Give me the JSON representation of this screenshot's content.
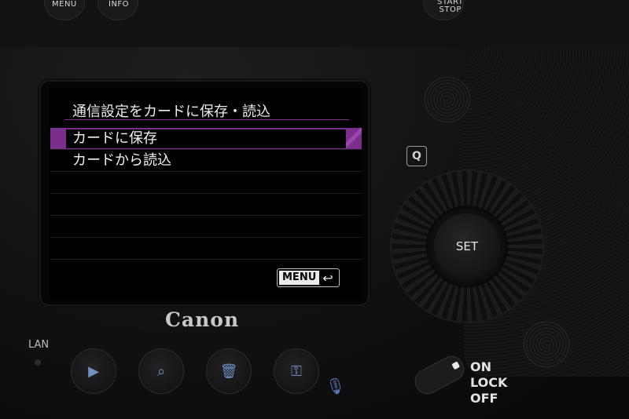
{
  "top_buttons": {
    "menu": "MENU",
    "info": "INFO",
    "start_stop": [
      "START",
      "STOP"
    ]
  },
  "lcd": {
    "title": "通信設定をカードに保存・読込",
    "items": [
      {
        "label": "カードに保存",
        "selected": true
      },
      {
        "label": "カードから読込",
        "selected": false
      }
    ],
    "back_button": "MENU",
    "accent_color": "#7c2e8c"
  },
  "brand": "Canon",
  "side_labels": {
    "lan": "LAN",
    "q": "Q",
    "set": "SET",
    "power": [
      "ON",
      "LOCK",
      "OFF"
    ]
  },
  "bottom_buttons": [
    {
      "icon": "playback-icon"
    },
    {
      "icon": "magnify-icon"
    },
    {
      "icon": "trash-icon"
    },
    {
      "icon": "protect-key-icon"
    }
  ]
}
